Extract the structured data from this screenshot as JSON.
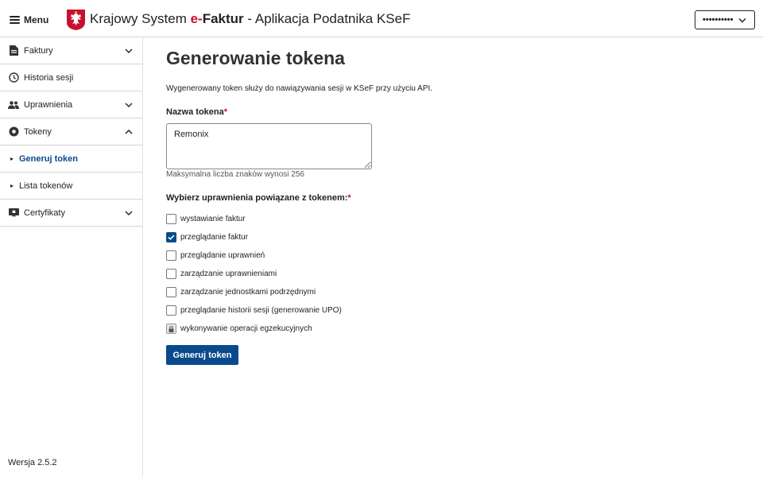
{
  "header": {
    "menu_label": "Menu",
    "title_prefix": "Krajowy System ",
    "title_e": "e-",
    "title_faktur": "Faktur",
    "title_suffix": " - Aplikacja Podatnika KSeF",
    "user_masked": "••••••••••",
    "colors": {
      "brand_red": "#c8102e",
      "accent_blue": "#0a4a8c"
    }
  },
  "sidebar": {
    "items": [
      {
        "label": "Faktury",
        "icon": "document-icon",
        "expandable": true,
        "expanded": false
      },
      {
        "label": "Historia sesji",
        "icon": "clock-icon",
        "expandable": false
      },
      {
        "label": "Uprawnienia",
        "icon": "people-icon",
        "expandable": true,
        "expanded": false
      },
      {
        "label": "Tokeny",
        "icon": "token-icon",
        "expandable": true,
        "expanded": true
      },
      {
        "label": "Certyfikaty",
        "icon": "certificate-icon",
        "expandable": true,
        "expanded": false
      }
    ],
    "sub_items": [
      {
        "label": "Generuj token",
        "active": true
      },
      {
        "label": "Lista tokenów",
        "active": false
      }
    ],
    "version": "Wersja 2.5.2"
  },
  "main": {
    "title": "Generowanie tokena",
    "description": "Wygenerowany token służy do nawiązywania sesji w KSeF przy użyciu API.",
    "name_label": "Nazwa tokena",
    "required_mark": "*",
    "name_value": "Remonix",
    "name_hint": "Maksymalna liczba znaków wynosi 256",
    "permissions_label": "Wybierz uprawnienia powiązane z tokenem:",
    "permissions": [
      {
        "label": "wystawianie faktur",
        "checked": false,
        "locked": false
      },
      {
        "label": "przeglądanie faktur",
        "checked": true,
        "locked": false
      },
      {
        "label": "przeglądanie uprawnień",
        "checked": false,
        "locked": false
      },
      {
        "label": "zarządzanie uprawnieniami",
        "checked": false,
        "locked": false
      },
      {
        "label": "zarządzanie jednostkami podrzędnymi",
        "checked": false,
        "locked": false
      },
      {
        "label": "przeglądanie historii sesji (generowanie UPO)",
        "checked": false,
        "locked": false
      },
      {
        "label": "wykonywanie operacji egzekucyjnych",
        "checked": false,
        "locked": true
      }
    ],
    "submit_label": "Generuj token"
  }
}
